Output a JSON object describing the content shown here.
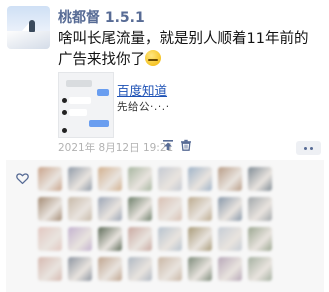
{
  "post": {
    "username": "桃都督 1.5.1",
    "text": "啥叫长尾流量，就是别人顺着11年前的广告来找你了",
    "emoji": "face-with-tears-emoji"
  },
  "link_card": {
    "title": "百度知道",
    "subtitle": "先给公·․·․·"
  },
  "meta": {
    "timestamp": "2021年 8月12日 19:21"
  },
  "likes": {
    "avatars": [
      {
        "color": "#c9a38a"
      },
      {
        "color": "#8f9aa8"
      },
      {
        "color": "#d2b08e"
      },
      {
        "color": "#a7b6a0"
      },
      {
        "color": "#c4c9d2"
      },
      {
        "color": "#9fb3c8"
      },
      {
        "color": "#b89c86"
      },
      {
        "color": "#7f8b95"
      },
      {
        "color": "#a48b74"
      },
      {
        "color": "#c7b9a8"
      },
      {
        "color": "#9aa4b5"
      },
      {
        "color": "#6d7f6a"
      },
      {
        "color": "#d8c0b3"
      },
      {
        "color": "#bba98d"
      },
      {
        "color": "#8797a9"
      },
      {
        "color": "#a0a6aa"
      },
      {
        "color": "#e2c7c0"
      },
      {
        "color": "#c3b2cf"
      },
      {
        "color": "#5d6b58"
      },
      {
        "color": "#c9a8a0"
      },
      {
        "color": "#b6c2ce"
      },
      {
        "color": "#a89a78"
      },
      {
        "color": "#c5ccd5"
      },
      {
        "color": "#9aa690"
      },
      {
        "color": "#d6b9b0"
      },
      {
        "color": "#8c94a0"
      },
      {
        "color": "#bfa48e"
      },
      {
        "color": "#aeb7c2"
      },
      {
        "color": "#c9b6a4"
      },
      {
        "color": "#7c8a79"
      },
      {
        "color": "#b7a7b8"
      },
      {
        "color": "#a4b0a0"
      }
    ]
  }
}
